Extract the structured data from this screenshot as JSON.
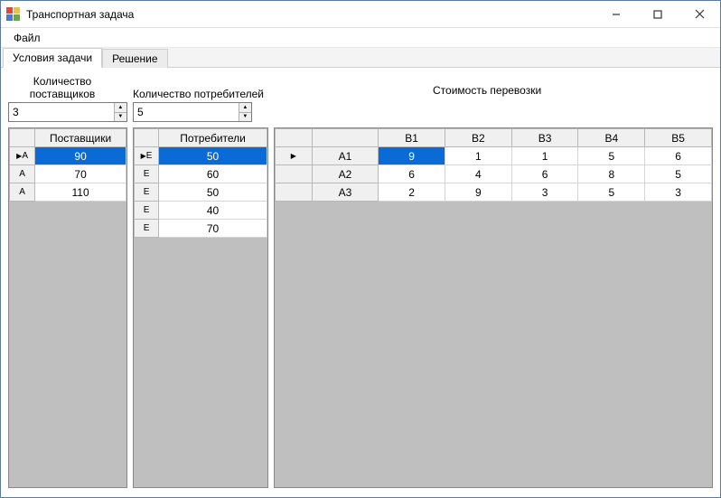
{
  "window": {
    "title": "Транспортная задача"
  },
  "menu": {
    "file": "Файл"
  },
  "tabs": {
    "conditions": "Условия задачи",
    "solution": "Решение"
  },
  "labels": {
    "suppliers_count": "Количество поставщиков",
    "consumers_count": "Количество потребителей",
    "cost_title": "Стоимость перевозки"
  },
  "inputs": {
    "suppliers": "3",
    "consumers": "5"
  },
  "suppliers_grid": {
    "header": "Поставщики",
    "rows": [
      {
        "label": "A",
        "value": "90"
      },
      {
        "label": "A",
        "value": "70"
      },
      {
        "label": "A",
        "value": "110"
      }
    ]
  },
  "consumers_grid": {
    "header": "Потребители",
    "rows": [
      {
        "label": "E",
        "value": "50"
      },
      {
        "label": "E",
        "value": "60"
      },
      {
        "label": "E",
        "value": "50"
      },
      {
        "label": "E",
        "value": "40"
      },
      {
        "label": "E",
        "value": "70"
      }
    ]
  },
  "cost_grid": {
    "col_headers": [
      "B1",
      "B2",
      "B3",
      "B4",
      "B5"
    ],
    "row_headers": [
      "A1",
      "A2",
      "A3"
    ],
    "values": [
      [
        "9",
        "1",
        "1",
        "5",
        "6"
      ],
      [
        "6",
        "4",
        "6",
        "8",
        "5"
      ],
      [
        "2",
        "9",
        "3",
        "5",
        "3"
      ]
    ]
  }
}
